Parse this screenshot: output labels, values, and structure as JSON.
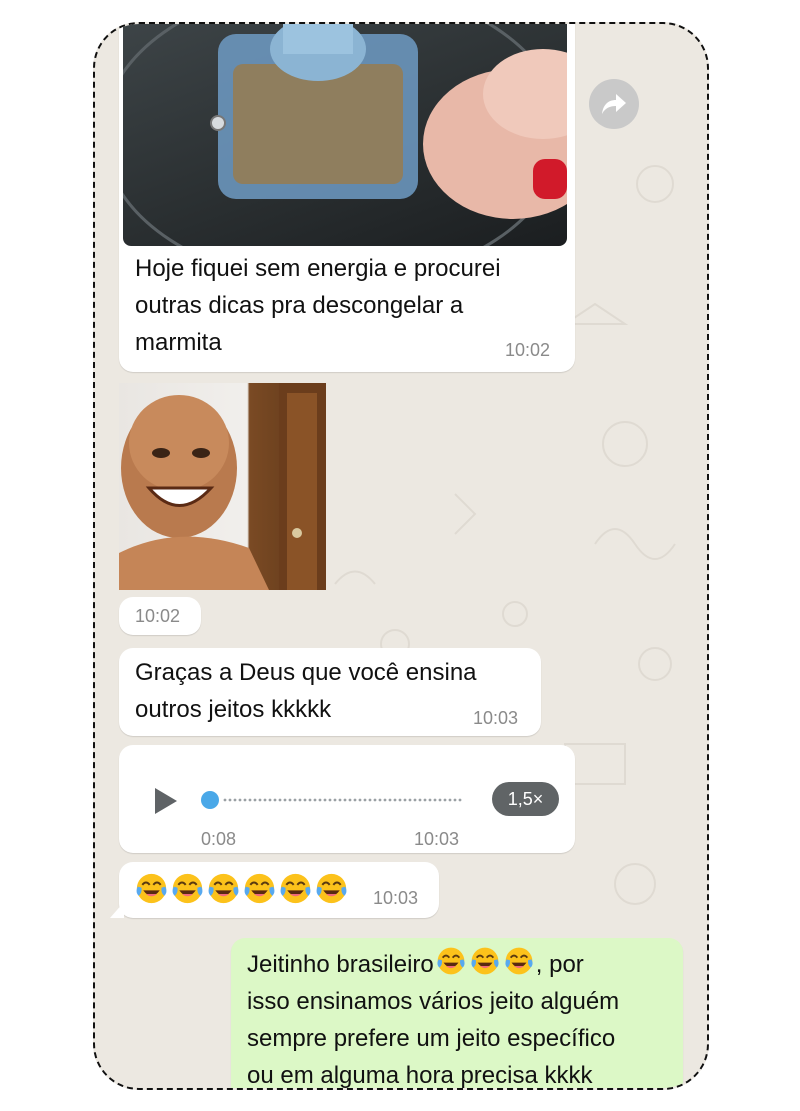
{
  "messages": {
    "video_caption": {
      "text": "Hoje fiquei sem energia e procurei outras dicas pra descongelar a marmita",
      "line1": "Hoje fiquei sem energia e procurei",
      "line2": "outras dicas pra descongelar a",
      "line3": "marmita",
      "time": "10:02"
    },
    "photo": {
      "time": "10:02"
    },
    "reply": {
      "line1": "Graças a Deus que você ensina",
      "line2": "outros jeitos kkkkk",
      "time": "10:03"
    },
    "voice": {
      "duration": "0:08",
      "time": "10:03",
      "speed": "1,5×",
      "progress": 0.0,
      "play_icon": "play-icon"
    },
    "emojis": {
      "count": 6,
      "icon": "tears-of-joy-emoji",
      "time": "10:03"
    },
    "outgoing": {
      "line1_a": "Jeitinho brasileiro",
      "line1_b": ", por",
      "line2": "isso ensinamos vários jeito alguém",
      "line3": "sempre prefere um jeito específico",
      "line4": "ou em alguma hora precisa kkkk"
    }
  },
  "icons": {
    "forward": "forward-icon"
  },
  "colors": {
    "incoming": "#ffffff",
    "outgoing": "#dcf8c6",
    "chat_bg": "#ece8e1",
    "voice_dot": "#4aa8e8",
    "speed_pill": "#606466"
  }
}
